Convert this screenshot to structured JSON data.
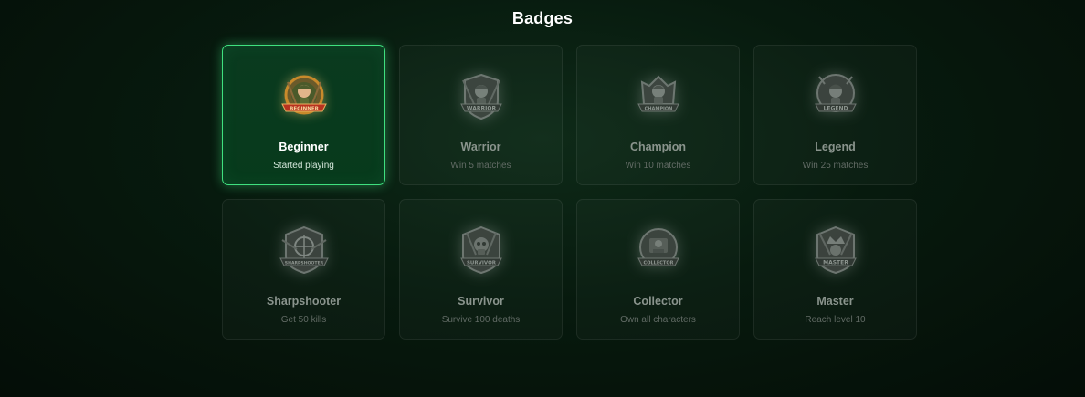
{
  "header": {
    "title": "Badges"
  },
  "badges": [
    {
      "name": "Beginner",
      "description": "Started playing",
      "icon": "beginner-badge-icon",
      "unlocked": true,
      "banner": "BEGINNER"
    },
    {
      "name": "Warrior",
      "description": "Win 5 matches",
      "icon": "warrior-badge-icon",
      "unlocked": false,
      "banner": "WARRIOR"
    },
    {
      "name": "Champion",
      "description": "Win 10 matches",
      "icon": "champion-badge-icon",
      "unlocked": false,
      "banner": "CHAMPION"
    },
    {
      "name": "Legend",
      "description": "Win 25 matches",
      "icon": "legend-badge-icon",
      "unlocked": false,
      "banner": "LEGEND"
    },
    {
      "name": "Sharpshooter",
      "description": "Get 50 kills",
      "icon": "sharpshooter-badge-icon",
      "unlocked": false,
      "banner": "SHARPSHOOTER"
    },
    {
      "name": "Survivor",
      "description": "Survive 100 deaths",
      "icon": "survivor-badge-icon",
      "unlocked": false,
      "banner": "SURVIVOR"
    },
    {
      "name": "Collector",
      "description": "Own all characters",
      "icon": "collector-badge-icon",
      "unlocked": false,
      "banner": "COLLECTOR"
    },
    {
      "name": "Master",
      "description": "Reach level 10",
      "icon": "master-badge-icon",
      "unlocked": false,
      "banner": "MASTER"
    }
  ],
  "colors": {
    "accent": "#3fe07f",
    "unlocked_bg": "#073a1c",
    "badge_gold": "#c98a2b",
    "badge_banner_red": "#b8321f"
  }
}
